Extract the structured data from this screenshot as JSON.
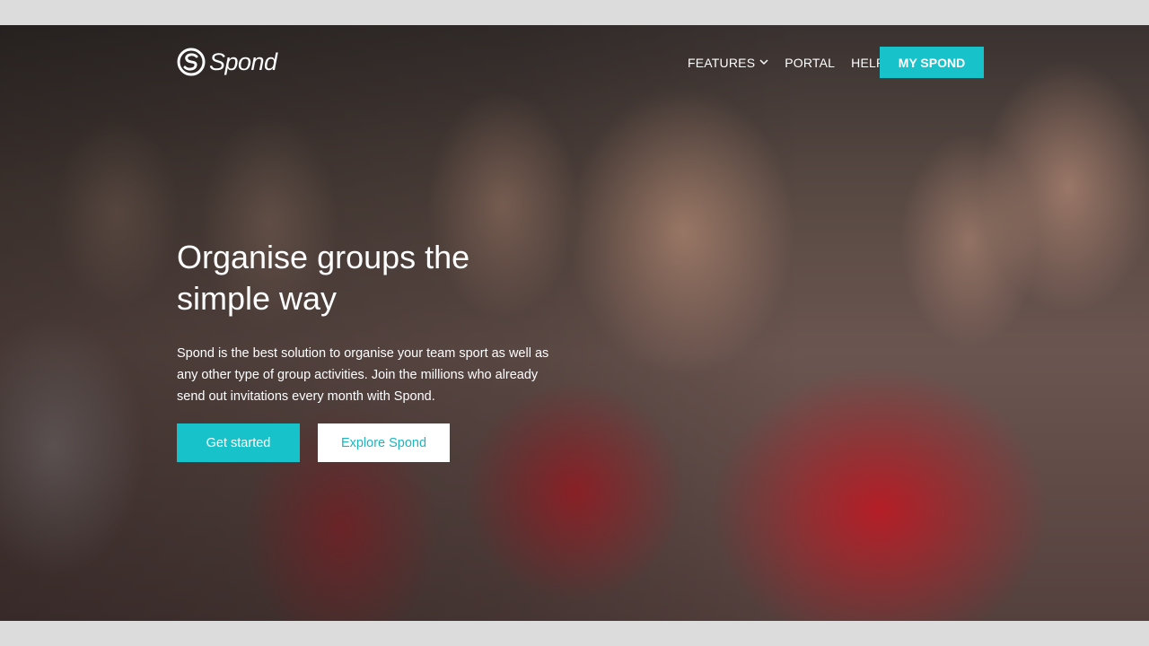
{
  "brand": {
    "name": "Spond",
    "logo_icon": "spond-logo-icon"
  },
  "nav": {
    "items": [
      {
        "label": "FEATURES",
        "has_dropdown": true
      },
      {
        "label": "PORTAL"
      },
      {
        "label": "HELP"
      }
    ],
    "cta_label": "MY SPOND"
  },
  "hero": {
    "headline_line1": "Organise groups the",
    "headline_line2": "simple way",
    "description": "Spond is the best solution to organise your team sport as well as any other type of group activities. Join the millions who already send out invitations every month with Spond.",
    "primary_button": "Get started",
    "secondary_button": "Explore Spond"
  },
  "colors": {
    "accent": "#17c2cb",
    "page_bg": "#dcdcdc"
  }
}
